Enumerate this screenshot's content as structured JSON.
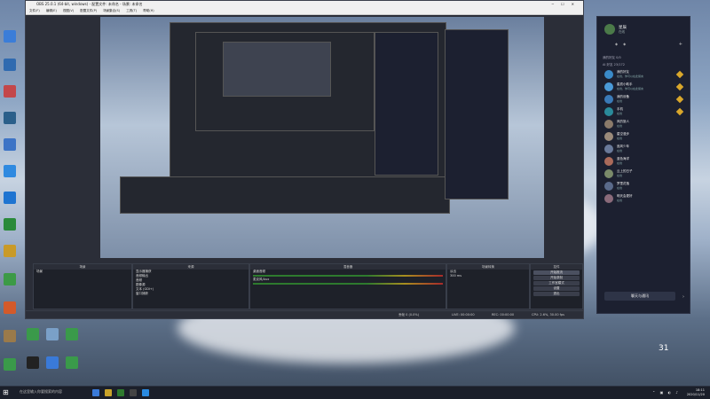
{
  "obs": {
    "title": "OBS 25.0.1 (64-bit, windows) - 配置文件: 未命名 - 场景: 未命名",
    "menu": [
      "文件(F)",
      "编辑(E)",
      "视图(V)",
      "配置文件(P)",
      "场景集合(S)",
      "工具(T)",
      "帮助(H)"
    ],
    "docks": {
      "scenes_header": "场景",
      "scene_items": [
        "场景"
      ],
      "sources_header": "来源",
      "source_items": [
        "显示器捕获",
        "音频输出",
        "音频",
        "图像源",
        "文本 (GDI+)",
        "窗口捕获"
      ],
      "mixer_header": "混音器",
      "mixer_tracks": [
        "桌面音频",
        "麦克风/Aux"
      ],
      "transitions_header": "场景转换",
      "transition_fade": "淡出",
      "transition_duration": "300 ms",
      "controls_header": "控件",
      "controls": [
        "开始推流",
        "开始录制",
        "工作室模式",
        "设置",
        "退出"
      ]
    },
    "status": {
      "drops": "丢帧 0 (0.0%)",
      "live": "LIVE: 00:00:00",
      "rec": "REC: 00:00:00",
      "cpu": "CPU: 2.6%, 30.00 fps"
    }
  },
  "qq": {
    "name": "星辰",
    "status": "在线",
    "groups": [
      "我的好友 0/0",
      "AI 好友 23/172"
    ],
    "friends": [
      {
        "name": "我的好友",
        "status": "在线，你可以在此留言"
      },
      {
        "name": "星辰小助手",
        "status": "在线，你可以在此留言"
      },
      {
        "name": "我的设备",
        "status": "在线"
      },
      {
        "name": "手机",
        "status": "在线"
      },
      {
        "name": "风的旅人",
        "status": "在线"
      },
      {
        "name": "星空漫步",
        "status": "在线"
      },
      {
        "name": "追风少年",
        "status": "在线"
      },
      {
        "name": "蓝色海洋",
        "status": "在线"
      },
      {
        "name": "云上的日子",
        "status": "在线"
      },
      {
        "name": "梦里花落",
        "status": "在线"
      },
      {
        "name": "明天会更好",
        "status": "在线"
      }
    ],
    "bottom_button": "聊天与通讯"
  },
  "taskbar": {
    "search_placeholder": "在这里输入你要搜索的内容",
    "time": "18:11",
    "date": "2020/11/20"
  },
  "widget": {
    "temp": "31"
  }
}
